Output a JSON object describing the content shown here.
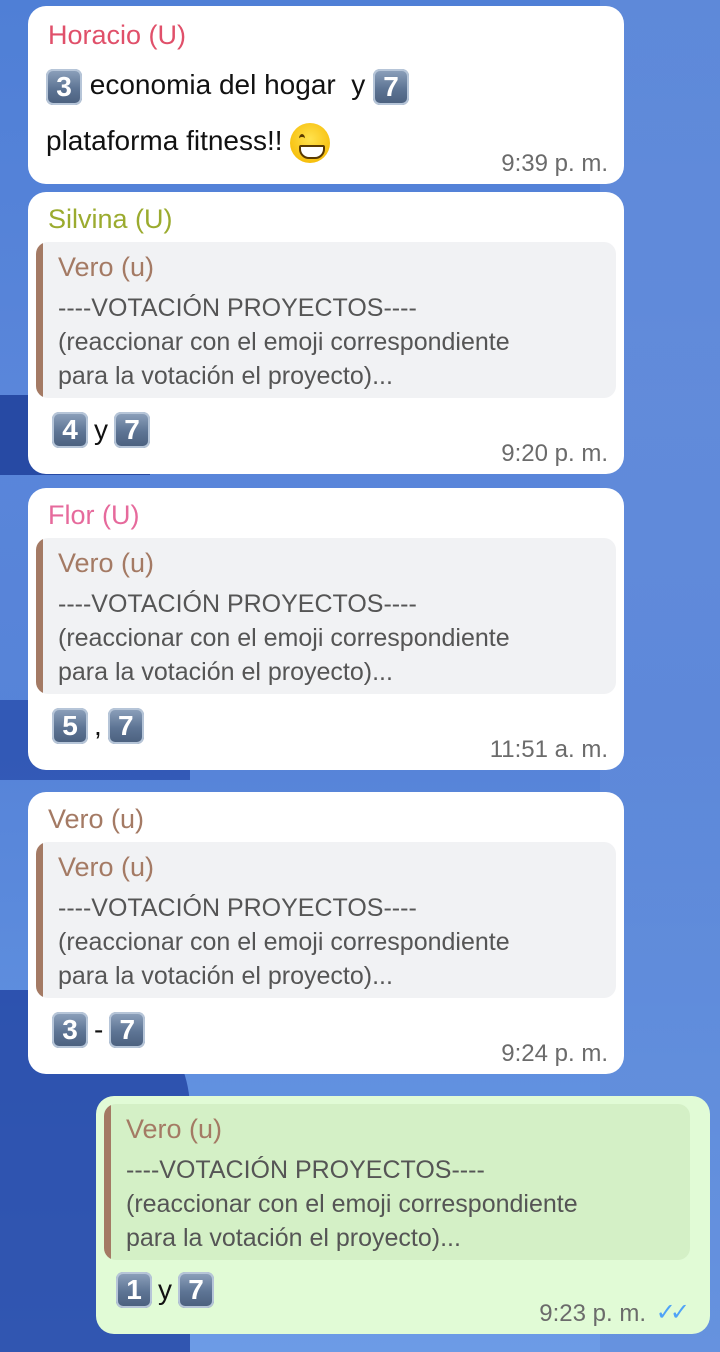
{
  "messages": [
    {
      "sender": "Horacio (U)",
      "sender_color": "#e0506a",
      "line1_keycap_a": "3",
      "line1_text": "economia del hogar  y",
      "line1_keycap_b": "7",
      "line2_text": "plataforma fitness!!",
      "emoji": "grinning-face-with-smiling-eyes",
      "time": "9:39 p. m."
    },
    {
      "sender": "Silvina (U)",
      "sender_color": "#9bab2f",
      "quote_author": "Vero (u)",
      "quote_lines": [
        "----VOTACIÓN PROYECTOS----",
        "(reaccionar con el emoji correspondiente",
        "para la votación el proyecto)..."
      ],
      "vote": {
        "a": "4",
        "sep": "y",
        "b": "7"
      },
      "time": "9:20 p. m."
    },
    {
      "sender": "Flor (U)",
      "sender_color": "#e66a9c",
      "quote_author": "Vero (u)",
      "quote_lines": [
        "----VOTACIÓN PROYECTOS----",
        "(reaccionar con el emoji correspondiente",
        "para la votación el proyecto)..."
      ],
      "vote": {
        "a": "5",
        "sep": ",",
        "b": "7"
      },
      "time": "11:51 a. m."
    },
    {
      "sender": "Vero (u)",
      "sender_color": "#a47a64",
      "quote_author": "Vero (u)",
      "quote_lines": [
        "----VOTACIÓN PROYECTOS----",
        "(reaccionar con el emoji correspondiente",
        "para la votación el proyecto)..."
      ],
      "vote": {
        "a": "3",
        "sep": "-",
        "b": "7"
      },
      "time": "9:24 p. m."
    },
    {
      "quote_author": "Vero (u)",
      "quote_lines": [
        "----VOTACIÓN PROYECTOS----",
        "(reaccionar con el emoji correspondiente",
        "para la votación el proyecto)..."
      ],
      "vote": {
        "a": "1",
        "sep": "y",
        "b": "7"
      },
      "time": "9:23 p. m.",
      "status": "read-double-check-icon"
    }
  ],
  "colors": {
    "incoming_bubble": "#ffffff",
    "outgoing_bubble": "#e1fbd6",
    "quote_accent": "#a47a64",
    "read_ticks": "#4fa3f7"
  }
}
